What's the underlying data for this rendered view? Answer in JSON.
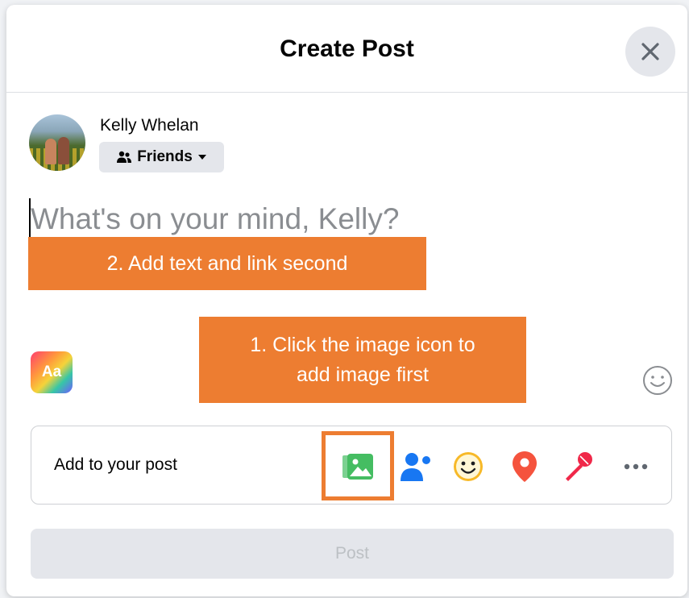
{
  "dialog": {
    "title": "Create Post"
  },
  "user": {
    "name": "Kelly Whelan",
    "audience": "Friends"
  },
  "composer": {
    "placeholder": "What's on your mind, Kelly?",
    "value": ""
  },
  "annotations": {
    "callout_second": "2. Add text and link second",
    "callout_first_line1": "1. Click the image icon to",
    "callout_first_line2": "add image first",
    "highlight_color": "#ed7d31"
  },
  "background_picker": {
    "label": "Aa"
  },
  "add_to_post": {
    "label": "Add to your post",
    "tools": [
      {
        "name": "photo-video",
        "color": "#45bd62"
      },
      {
        "name": "tag-people",
        "color": "#1877f2"
      },
      {
        "name": "feeling-activity",
        "color": "#f7b928"
      },
      {
        "name": "check-in",
        "color": "#f5533d"
      },
      {
        "name": "live-video",
        "color": "#f02849"
      },
      {
        "name": "more",
        "color": "#606770"
      }
    ]
  },
  "post_button": {
    "label": "Post"
  }
}
